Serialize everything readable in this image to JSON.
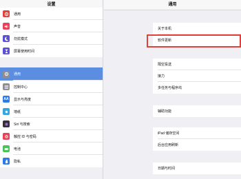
{
  "left": {
    "title": "设置",
    "items": [
      {
        "label": "通用",
        "icon": "gear-icon",
        "color": "#e0443b"
      },
      {
        "label": "声音",
        "icon": "speaker-icon",
        "color": "#e8415a"
      },
      {
        "label": "勿扰模式",
        "icon": "moon-icon",
        "color": "#5b4fd6"
      },
      {
        "label": "屏幕使用时间",
        "icon": "hourglass-icon",
        "color": "#5b4fd6"
      },
      {
        "label": "通用",
        "icon": "gear-icon",
        "color": "#8e8e93"
      },
      {
        "label": "控制中心",
        "icon": "switches-icon",
        "color": "#8e8e93"
      },
      {
        "label": "显示与亮度",
        "icon": "brightness-icon",
        "color": "#2f7be6"
      },
      {
        "label": "墙纸",
        "icon": "flower-icon",
        "color": "#34a6e0"
      },
      {
        "label": "Siri 与搜索",
        "icon": "siri-icon",
        "color": "#333333"
      },
      {
        "label": "触控 ID 与密码",
        "icon": "fingerprint-icon",
        "color": "#e8415a"
      },
      {
        "label": "电池",
        "icon": "battery-icon",
        "color": "#4cc35a"
      },
      {
        "label": "隐私",
        "icon": "hand-icon",
        "color": "#2f7be6"
      }
    ]
  },
  "right": {
    "title": "通用",
    "items": [
      "关于本机",
      "软件更新",
      "隔空投送",
      "接力",
      "多任务与程序坞",
      "辅助功能",
      "iPad 储存空间",
      "后台应用刷新",
      "日期与时间"
    ]
  },
  "colors": {
    "selected_row": "#5b8de0",
    "highlight_border": "#e0403a"
  }
}
